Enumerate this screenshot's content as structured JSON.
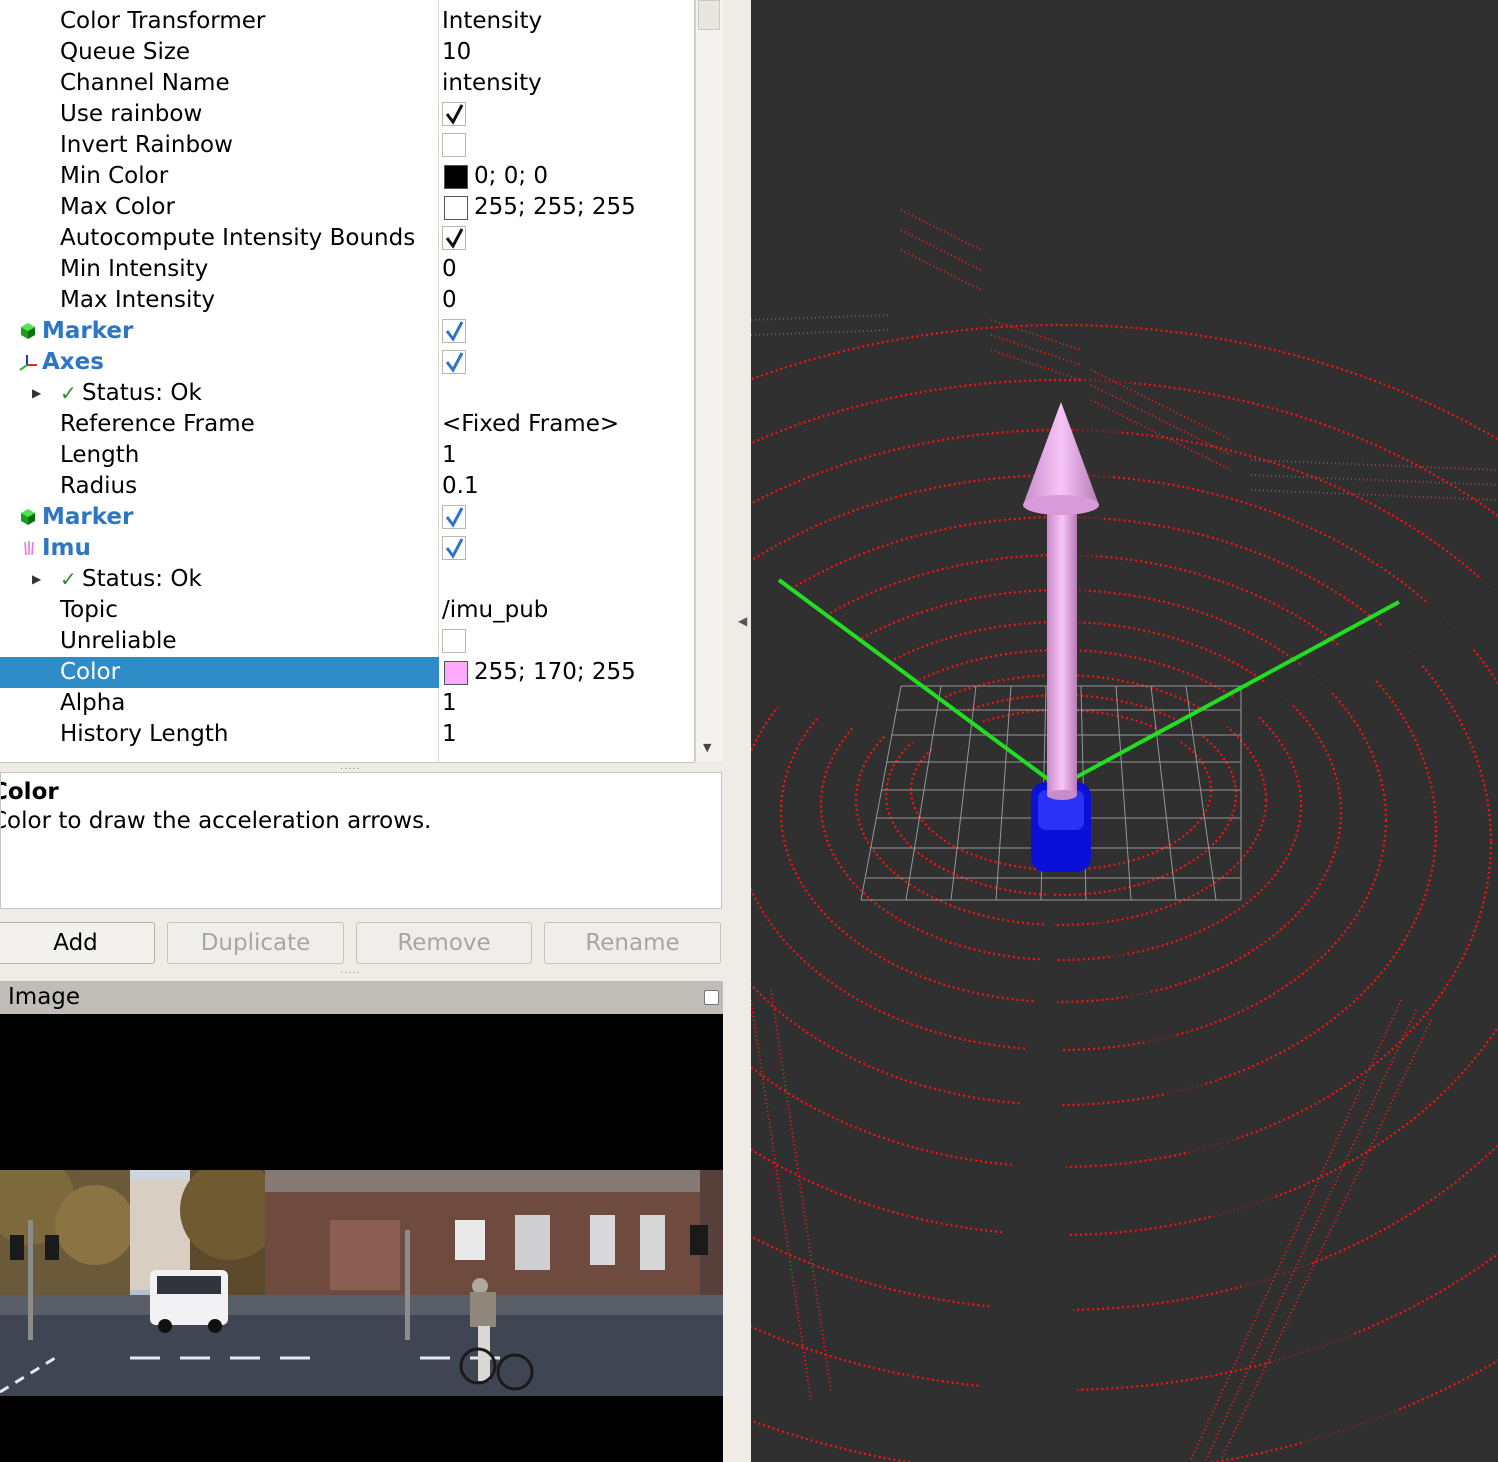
{
  "properties": {
    "rows": [
      {
        "name": "Color Transformer",
        "value": "Intensity"
      },
      {
        "name": "Queue Size",
        "value": "10"
      },
      {
        "name": "Channel Name",
        "value": "intensity"
      },
      {
        "name": "Use rainbow",
        "checked": true
      },
      {
        "name": "Invert Rainbow",
        "checked": false
      },
      {
        "name": "Min Color",
        "value": "0; 0; 0",
        "swatch": "#000000"
      },
      {
        "name": "Max Color",
        "value": "255; 255; 255",
        "swatch": "#ffffff"
      },
      {
        "name": "Autocompute Intensity Bounds",
        "checked": true
      },
      {
        "name": "Min Intensity",
        "value": "0"
      },
      {
        "name": "Max Intensity",
        "value": "0"
      },
      {
        "name": "Marker",
        "checked": true,
        "icon": "marker-cube-icon"
      },
      {
        "name": "Axes",
        "checked": true,
        "icon": "axes-icon"
      },
      {
        "name": "Status: Ok",
        "icon": "status-ok-check-icon"
      },
      {
        "name": "Reference Frame",
        "value": "<Fixed Frame>"
      },
      {
        "name": "Length",
        "value": "1"
      },
      {
        "name": "Radius",
        "value": "0.1"
      },
      {
        "name": "Marker",
        "checked": true,
        "icon": "marker-cube-icon"
      },
      {
        "name": "Imu",
        "checked": true,
        "icon": "imu-icon"
      },
      {
        "name": "Status: Ok",
        "icon": "status-ok-check-icon"
      },
      {
        "name": "Topic",
        "value": "/imu_pub"
      },
      {
        "name": "Unreliable",
        "checked": false
      },
      {
        "name": "Color",
        "value": "255; 170; 255",
        "swatch": "#ffaaff"
      },
      {
        "name": "Alpha",
        "value": "1"
      },
      {
        "name": "History Length",
        "value": "1"
      }
    ]
  },
  "description": {
    "title": "Color",
    "text": "Color to draw the acceleration arrows."
  },
  "buttons": {
    "add": "Add",
    "duplicate": "Duplicate",
    "remove": "Remove",
    "rename": "Rename"
  },
  "image_panel": {
    "title": "Image"
  },
  "colors": {
    "selection": "#308cc6",
    "display_name": "#2e75c4",
    "point_cloud": "#ff0000",
    "axis_lines": "#22dd22",
    "imu_arrow": "#ffaaff",
    "vehicle": "#0a10d8",
    "render_background": "#303030"
  }
}
